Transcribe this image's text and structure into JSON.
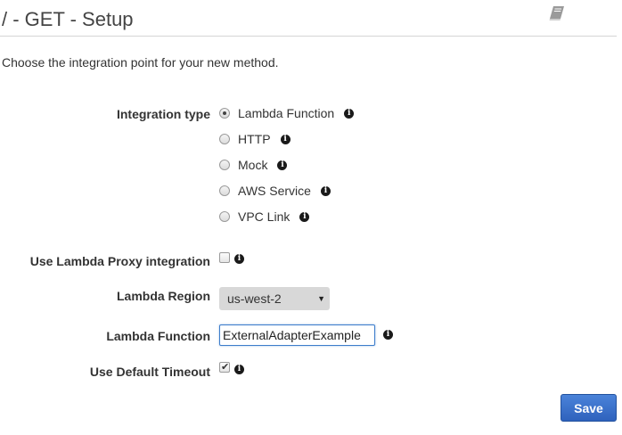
{
  "header": {
    "title": "/ - GET - Setup",
    "book_icon": "book-icon"
  },
  "intro": "Choose the integration point for your new method.",
  "integration_type": {
    "label": "Integration type",
    "options": [
      {
        "label": "Lambda Function",
        "checked": true
      },
      {
        "label": "HTTP",
        "checked": false
      },
      {
        "label": "Mock",
        "checked": false
      },
      {
        "label": "AWS Service",
        "checked": false
      },
      {
        "label": "VPC Link",
        "checked": false
      }
    ]
  },
  "proxy": {
    "label": "Use Lambda Proxy integration",
    "checked": false
  },
  "region": {
    "label": "Lambda Region",
    "value": "us-west-2"
  },
  "function": {
    "label": "Lambda Function",
    "value": "ExternalAdapterExample"
  },
  "timeout": {
    "label": "Use Default Timeout",
    "checked": true
  },
  "actions": {
    "save_label": "Save"
  },
  "colors": {
    "accent": "#2f62bd",
    "focus_border": "#3d7dcb",
    "divider": "#d5d5d5"
  }
}
